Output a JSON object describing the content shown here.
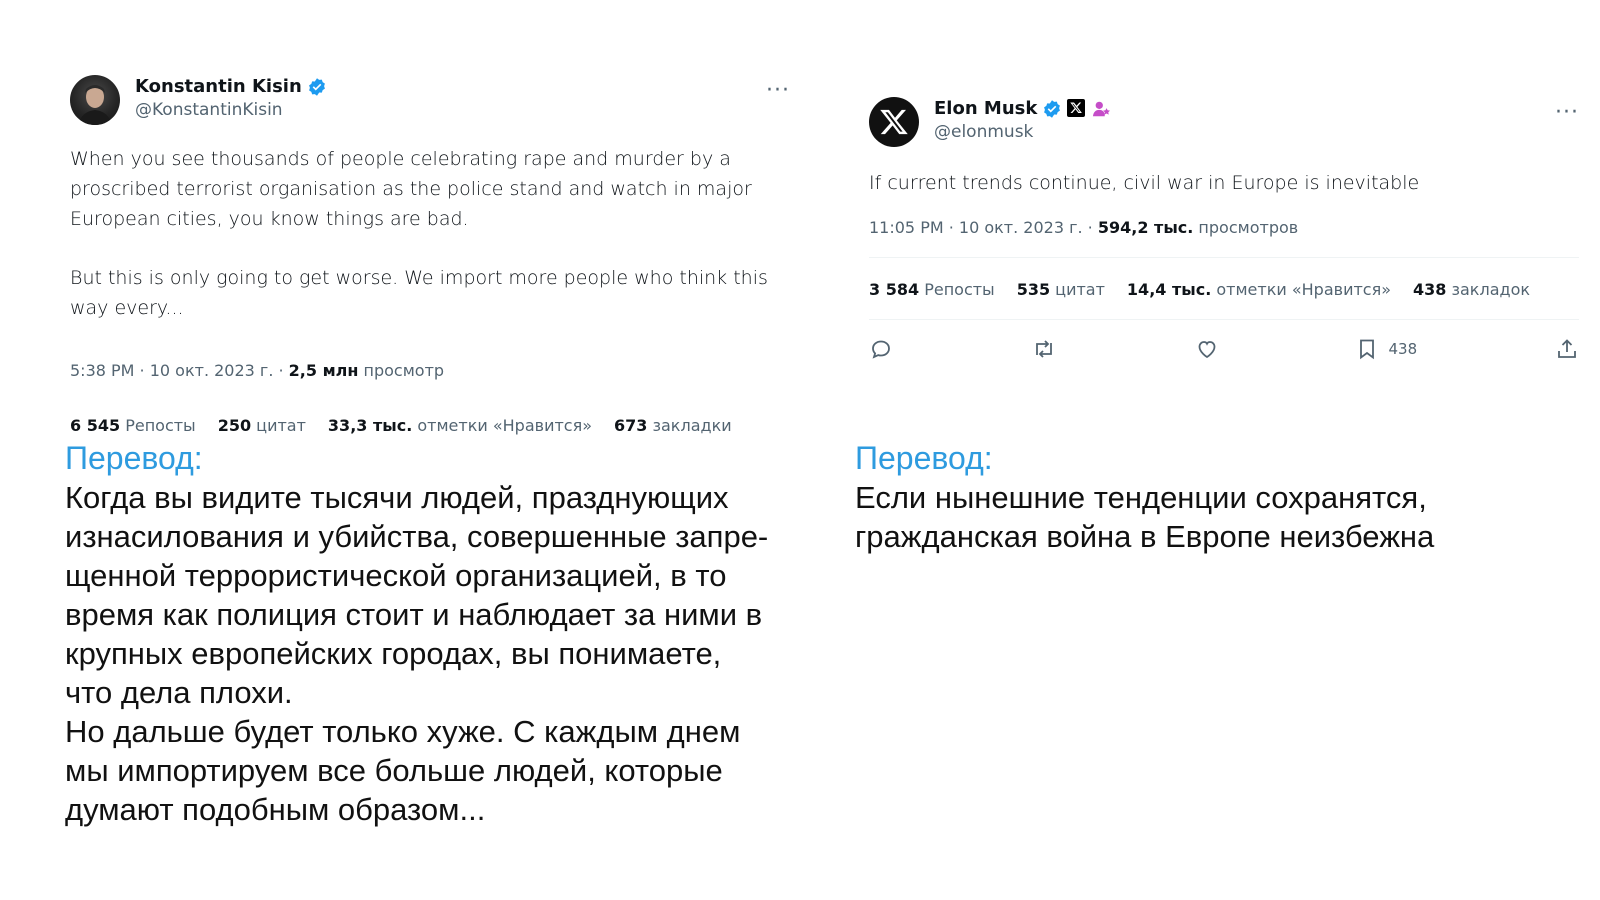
{
  "tweet_left": {
    "name": "Konstantin Kisin",
    "handle": "@KonstantinKisin",
    "more": "···",
    "paragraph1": "When you see thousands of people celebrating rape and murder by a proscribed terrorist organisation as the police stand and watch in major European cities, you know things are bad.",
    "paragraph2": "But this is only going to get worse. We import more people who think this way every...",
    "meta_time": "5:38 PM · 10 окт. 2023 г. · ",
    "meta_views_num": "2,5 млн",
    "meta_views_label": " просмотр",
    "stats": [
      {
        "num": "6 545",
        "label": " Репосты"
      },
      {
        "num": "250",
        "label": " цитат"
      },
      {
        "num": "33,3 тыс.",
        "label": " отметки «Нравится»"
      },
      {
        "num": "673",
        "label": " закладки"
      }
    ]
  },
  "tweet_right": {
    "name": "Elon Musk",
    "handle": "@elonmusk",
    "more": "···",
    "text": "If current trends continue, civil war in Europe is inevitable",
    "meta_time": "11:05 PM · 10 окт. 2023 г. · ",
    "meta_views_num": "594,2 тыс.",
    "meta_views_label": " просмотров",
    "stats": [
      {
        "num": "3 584",
        "label": " Репосты"
      },
      {
        "num": "535",
        "label": " цитат"
      },
      {
        "num": "14,4 тыс.",
        "label": " отметки «Нравится»"
      },
      {
        "num": "438",
        "label": " закладок"
      }
    ],
    "bookmark_count": "438",
    "icons": [
      "reply-icon",
      "repost-icon",
      "like-icon",
      "bookmark-icon",
      "share-icon"
    ]
  },
  "translation_left": {
    "label": "Перевод:",
    "text": "Когда вы видите тысячи людей, празднующих\nизнасилования и убийства, совершенные запре-\nщенной террористической организацией, в то\nвремя как полиция стоит и наблюдает за ними в\nкрупных европейских городах, вы понимаете,\nчто дела плохи.\nНо дальше будет только хуже. С каждым днем\nмы импортируем все больше людей, которые\nдумают подобным образом..."
  },
  "translation_right": {
    "label": "Перевод:",
    "text": "Если нынешние тенденции сохранятся,\nгражданская война в Европе неизбежна"
  },
  "colors": {
    "verified": "#1d9bf0",
    "translation_label": "#2e9bdf",
    "secondary_text": "#536471"
  }
}
